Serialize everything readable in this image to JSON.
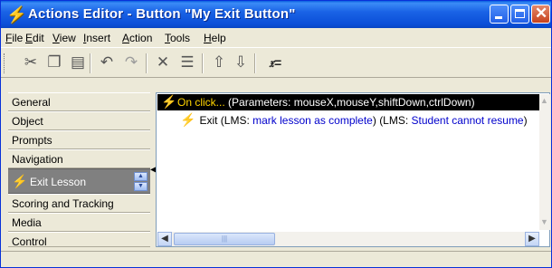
{
  "window": {
    "title": "Actions Editor - Button \"My Exit Button\""
  },
  "menu": [
    "File",
    "Edit",
    "View",
    "Insert",
    "Action",
    "Tools",
    "Help"
  ],
  "toolbar": {
    "cut_icon": "scissors-icon",
    "copy_icon": "copy-icon",
    "paste_icon": "paste-icon",
    "undo_icon": "undo-icon",
    "redo_icon": "redo-icon",
    "delete_icon": "delete-icon",
    "properties_icon": "properties-icon",
    "move_up_icon": "arrow-up-icon",
    "move_down_icon": "arrow-down-icon",
    "variables_icon": "variables-icon"
  },
  "left_tabs": [
    "General",
    "Object",
    "Prompts",
    "Navigation",
    "Exit Lesson",
    "Scoring and Tracking",
    "Media",
    "Control"
  ],
  "active_tab": "Exit Lesson",
  "actions": {
    "event_label": "On click...",
    "event_params": "(Parameters: mouseX,mouseY,shiftDown,ctrlDown)",
    "action_prefix": "Exit (LMS: ",
    "action_lms1": "mark lesson as complete",
    "action_mid": ") (LMS: ",
    "action_lms2": "Student cannot resume",
    "action_suffix": ")"
  },
  "colors": {
    "title_bar": "#0b4fd8",
    "selected_row": "#000000",
    "lightning": "#ffd400",
    "link_blue": "#0000cc"
  }
}
